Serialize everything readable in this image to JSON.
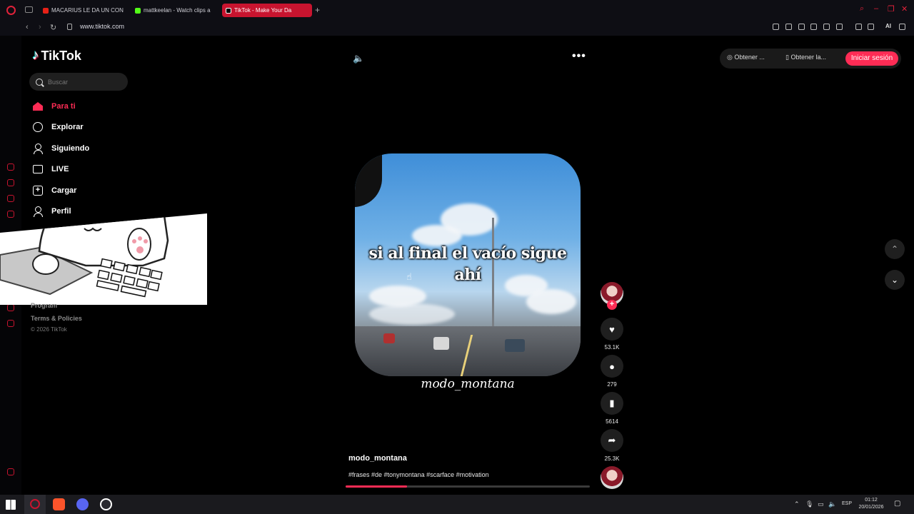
{
  "browser": {
    "tabs": [
      {
        "label": "MACARIUS LE DA UN CON",
        "favicon_color": "#e62117"
      },
      {
        "label": "mattkeelan - Watch clips a",
        "favicon_color": "#53fc18"
      },
      {
        "label": "TikTok - Make Your Da",
        "favicon_color": "#000000"
      }
    ],
    "url": "www.tiktok.com",
    "ai_label": "AI"
  },
  "sidebar": {
    "brand": "TikTok",
    "search_placeholder": "Buscar",
    "items": [
      {
        "label": "Para ti",
        "icon": "home-icon"
      },
      {
        "label": "Explorar",
        "icon": "compass-icon"
      },
      {
        "label": "Siguiendo",
        "icon": "following-icon"
      },
      {
        "label": "LIVE",
        "icon": "live-tv-icon"
      },
      {
        "label": "Cargar",
        "icon": "upload-icon"
      },
      {
        "label": "Perfil",
        "icon": "profile-icon"
      }
    ],
    "more_label": "...",
    "footer": {
      "program_label": "Program",
      "terms_label": "Terms & Policies",
      "copyright": "© 2026 TikTok"
    }
  },
  "header": {
    "get_app_label": "Obtener ...",
    "get_app2_label": "Obtener la...",
    "login_label": "Iniciar sesión"
  },
  "video": {
    "caption": "si al final el vacío sigue ahí",
    "watermark": "modo_montana",
    "author": "modo_montana",
    "hashtags": "#frases #de #tonymontana #scarface #motivation",
    "progress": 0.25
  },
  "actions": {
    "likes": "53.1K",
    "comments": "279",
    "saves": "5614",
    "shares": "25.3K"
  },
  "taskbar": {
    "language": "ESP",
    "time": "01:12",
    "date": "20/01/2026"
  },
  "colors": {
    "accent": "#fe2c55",
    "opera_red": "#c8142f"
  }
}
